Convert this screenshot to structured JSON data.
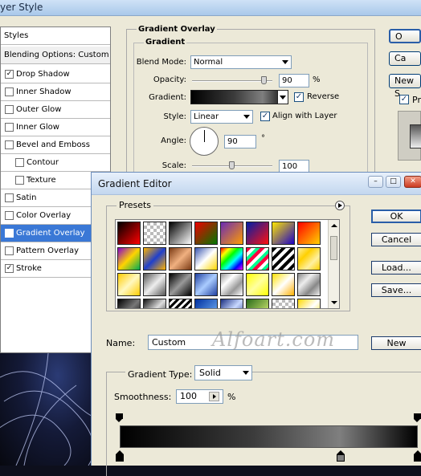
{
  "layer_style": {
    "title": "yer Style",
    "styles_header": "Styles",
    "blending_options": "Blending Options: Custom",
    "items": [
      {
        "label": "Drop Shadow",
        "checked": true
      },
      {
        "label": "Inner Shadow",
        "checked": false
      },
      {
        "label": "Outer Glow",
        "checked": false
      },
      {
        "label": "Inner Glow",
        "checked": false
      },
      {
        "label": "Bevel and Emboss",
        "checked": false
      },
      {
        "label": "Contour",
        "checked": false
      },
      {
        "label": "Texture",
        "checked": false
      },
      {
        "label": "Satin",
        "checked": false
      },
      {
        "label": "Color Overlay",
        "checked": false
      },
      {
        "label": "Gradient Overlay",
        "checked": true
      },
      {
        "label": "Pattern Overlay",
        "checked": false
      },
      {
        "label": "Stroke",
        "checked": true
      }
    ],
    "selected_item": "Gradient Overlay",
    "panel": {
      "section_title": "Gradient Overlay",
      "group_title": "Gradient",
      "blend_mode_label": "Blend Mode:",
      "blend_mode_value": "Normal",
      "opacity_label": "Opacity:",
      "opacity_value": "90",
      "opacity_unit": "%",
      "opacity_fraction": 0.9,
      "gradient_label": "Gradient:",
      "reverse_label": "Reverse",
      "reverse_checked": true,
      "style_label": "Style:",
      "style_value": "Linear",
      "align_label": "Align with Layer",
      "align_checked": true,
      "angle_label": "Angle:",
      "angle_value": "90",
      "angle_unit": "°",
      "scale_label": "Scale:",
      "scale_value": "100",
      "scale_fraction": 1.0
    },
    "buttons": {
      "ok_partial": "O",
      "cancel_partial": "Ca",
      "new_style_partial": "New S",
      "preview_partial": "Pr"
    }
  },
  "gradient_editor": {
    "title": "Gradient Editor",
    "presets_label": "Presets",
    "buttons": {
      "ok": "OK",
      "cancel": "Cancel",
      "load": "Load...",
      "save": "Save...",
      "new": "New"
    },
    "name_label": "Name:",
    "name_value": "Custom",
    "gradient_type_label": "Gradient Type:",
    "gradient_type_value": "Solid",
    "smoothness_label": "Smoothness:",
    "smoothness_value": "100",
    "smoothness_unit": "%",
    "stops": {
      "opacity": [
        0,
        100
      ],
      "color": [
        0,
        74,
        100
      ]
    },
    "presets": [
      [
        "linear-gradient(135deg,#000,#ff0000)",
        "repeating-conic-gradient(#bbb 0 25%,#fff 0 50%) 0 0/8px 8px",
        "linear-gradient(135deg,#000,#fff)",
        "linear-gradient(135deg,#e00,#070)",
        "linear-gradient(135deg,#6a2cb5,#ff9c00)",
        "linear-gradient(135deg,#001ea8,#ff1010)",
        "linear-gradient(135deg,#ffe800,#1c00c8)",
        "linear-gradient(135deg,#ff0000,#ffd200)"
      ],
      [
        "linear-gradient(135deg,#8800cc,#ffd400,#00aa55)",
        "linear-gradient(135deg,#ffb300,#1f3fcc,#ffb300)",
        "linear-gradient(135deg,#7a3a14,#f0b080,#7a3a14)",
        "linear-gradient(135deg,#3a56b0,#ffffff,#ffd700)",
        "linear-gradient(135deg,#f00,#ff0,#0f0,#0ff,#00f,#f0f)",
        "repeating-linear-gradient(135deg,#ff0040 0 4px,#fff 4px 8px,#00ff90 8px 12px)",
        "repeating-linear-gradient(135deg,#000 0 4px,#fff 4px 8px)",
        "linear-gradient(135deg,#fff0a0,#ffd000,#fff0a0,#ffd000)"
      ],
      [
        "linear-gradient(135deg,#ffcc00,#fff8c0,#ffcc00)",
        "linear-gradient(135deg,#555,#eee,#555)",
        "linear-gradient(135deg,#000,#999,#000)",
        "linear-gradient(135deg,#2040a0,#aaccff,#2040a0)",
        "linear-gradient(135deg,#999,#fff,#999,#fff)",
        "linear-gradient(135deg,#ff0,#ffffa0,#ff0)",
        "linear-gradient(135deg,#ffe000,#fff,#ffb000)",
        "linear-gradient(135deg,#888,#eee,#888,#eee)"
      ],
      [
        "linear-gradient(135deg,#000,#777,#000)",
        "linear-gradient(135deg,#111,#ddd,#111)",
        "repeating-linear-gradient(135deg,#000 0 3px,#fff 3px 6px)",
        "linear-gradient(135deg,#0030a0,#80c0ff)",
        "linear-gradient(135deg,#1a2f80,#c8d8ff,#1a2f80)",
        "linear-gradient(135deg,#2b6b1c,#f0ff80)",
        "repeating-conic-gradient(#bbb 0 25%,#fff 0 50%) 0 0/8px 8px",
        "linear-gradient(135deg,#ffd800,#ffffff,#ffd800)"
      ]
    ]
  }
}
